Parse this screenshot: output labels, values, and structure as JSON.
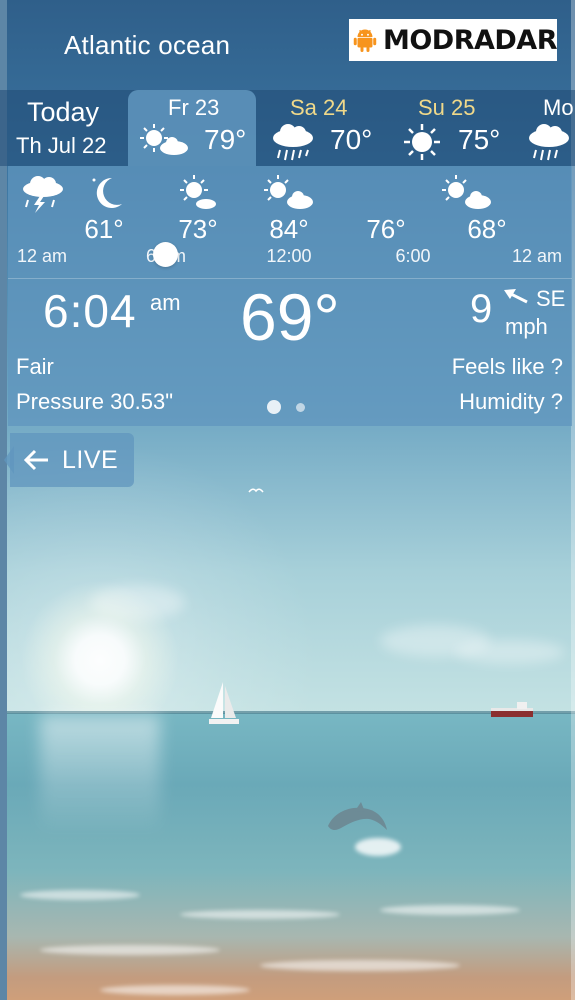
{
  "header": {
    "location": "Atlantic ocean",
    "brand": "MODRADAR",
    "brand_logo": "android-robot-icon",
    "brand_color": "#f7941d"
  },
  "days": [
    {
      "id": "today",
      "line1": "Today",
      "line2": "Th Jul 22"
    },
    {
      "id": "fr23",
      "name": "Fr 23",
      "temp": "79°",
      "icon": "partly-sunny-icon",
      "selected": true
    },
    {
      "id": "sa24",
      "name": "Sa 24",
      "temp": "70°",
      "icon": "rain-icon"
    },
    {
      "id": "su25",
      "name": "Su 25",
      "temp": "75°",
      "icon": "sun-icon"
    },
    {
      "id": "mo",
      "name": "Mo",
      "icon": "rain-icon"
    }
  ],
  "hourly": [
    {
      "time": "12 am",
      "temp": "",
      "icon": "thunderstorm-icon"
    },
    {
      "time": "6 am",
      "temp": "61°",
      "icon": "moon-icon"
    },
    {
      "time": "",
      "temp": "73°",
      "icon": "partly-sunny-icon"
    },
    {
      "time": "12:00",
      "temp": "84°",
      "icon": "partly-sunny-icon"
    },
    {
      "time": "6:00",
      "temp": "76°",
      "icon": ""
    },
    {
      "time": "12 am",
      "temp": "68°",
      "icon": "partly-sunny-icon"
    }
  ],
  "current": {
    "time": "6:04",
    "ampm": "am",
    "temp": "69°",
    "wind_speed": "9",
    "wind_dir": "SE",
    "wind_unit": "mph",
    "condition": "Fair",
    "pressure": "Pressure 30.53\"",
    "feels_like": "Feels like ?",
    "humidity": "Humidity ?"
  },
  "pager": {
    "pages": 2,
    "active": 1
  },
  "live_button": {
    "label": "LIVE"
  },
  "colors": {
    "panel": "#6096be",
    "tab_bar": "#204a74",
    "day_name_highlight": "#f0d98a"
  }
}
